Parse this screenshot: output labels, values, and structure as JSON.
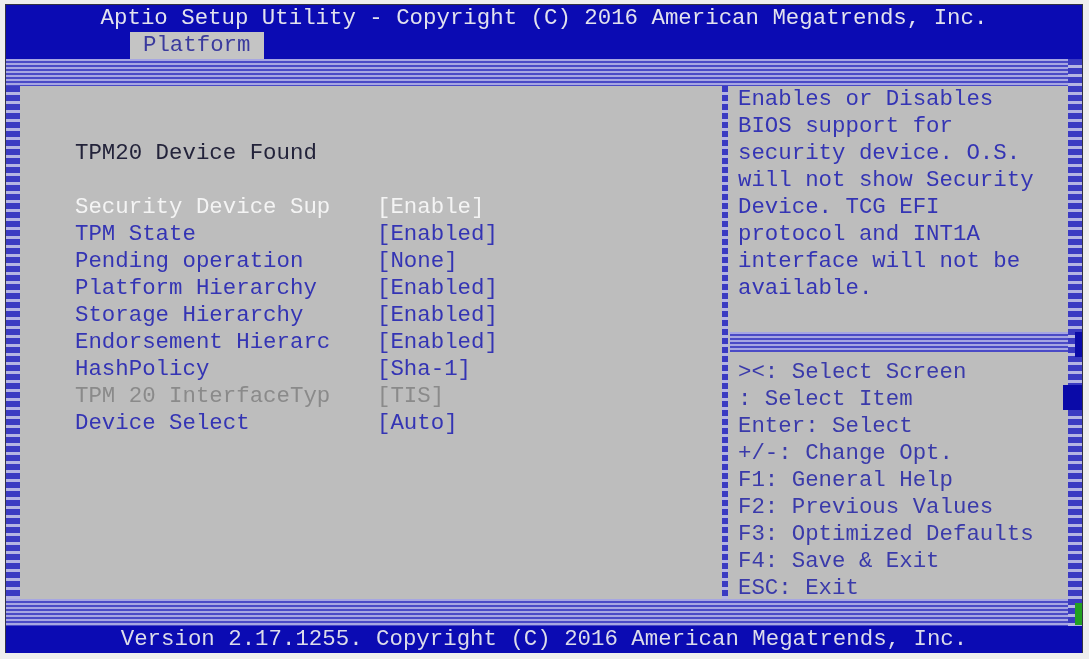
{
  "header": {
    "title": "Aptio Setup Utility - Copyright (C) 2016 American Megatrends, Inc.",
    "tabs": [
      {
        "label": "Platform",
        "selected": true
      }
    ]
  },
  "settings": {
    "heading": "TPM20 Device Found",
    "items": [
      {
        "label": "Security Device Sup",
        "value": "[Enable]",
        "selected": true,
        "disabled": false
      },
      {
        "label": "TPM State",
        "value": "[Enabled]",
        "selected": false,
        "disabled": false
      },
      {
        "label": "Pending operation",
        "value": "[None]",
        "selected": false,
        "disabled": false
      },
      {
        "label": "Platform Hierarchy",
        "value": "[Enabled]",
        "selected": false,
        "disabled": false
      },
      {
        "label": "Storage Hierarchy",
        "value": "[Enabled]",
        "selected": false,
        "disabled": false
      },
      {
        "label": "Endorsement Hierarc",
        "value": "[Enabled]",
        "selected": false,
        "disabled": false
      },
      {
        "label": "HashPolicy",
        "value": "[Sha-1]",
        "selected": false,
        "disabled": false
      },
      {
        "label": "TPM 20 InterfaceTyp",
        "value": "[TIS]",
        "selected": false,
        "disabled": true
      },
      {
        "label": "Device Select",
        "value": "[Auto]",
        "selected": false,
        "disabled": false
      }
    ]
  },
  "help": {
    "text": "Enables or Disables BIOS support for security device. O.S. will not show Security Device. TCG EFI protocol and INT1A interface will not be available.",
    "keys": [
      "><: Select Screen",
      ": Select Item",
      "Enter: Select",
      "+/-: Change Opt.",
      "F1: General Help",
      "F2: Previous Values",
      "F3: Optimized Defaults",
      "F4: Save & Exit",
      "ESC: Exit"
    ]
  },
  "footer": {
    "version": "Version 2.17.1255. Copyright (C) 2016 American Megatrends, Inc."
  }
}
